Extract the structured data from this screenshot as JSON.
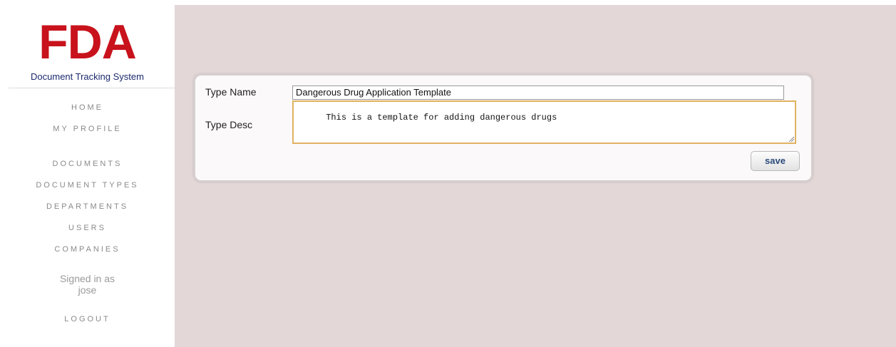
{
  "brand": {
    "logo": "FDA",
    "subtitle": "Document Tracking System",
    "logo_color": "#c8121c"
  },
  "nav": {
    "home": "HOME",
    "my_profile": "MY PROFILE",
    "documents": "DOCUMENTS",
    "document_types": "DOCUMENT TYPES",
    "departments": "DEPARTMENTS",
    "users": "USERS",
    "companies": "COMPANIES",
    "logout": "LOGOUT"
  },
  "session": {
    "signed_in_line1": "Signed in as",
    "username": "jose"
  },
  "form": {
    "type_name_label": "Type Name",
    "type_name_value": "Dangerous Drug Application Template",
    "type_desc_label": "Type Desc",
    "type_desc_value": "This is a template for adding dangerous drugs",
    "save_label": "save"
  },
  "colors": {
    "main_background": "#e3d7d7",
    "textarea_focus_border": "#e0b262"
  }
}
